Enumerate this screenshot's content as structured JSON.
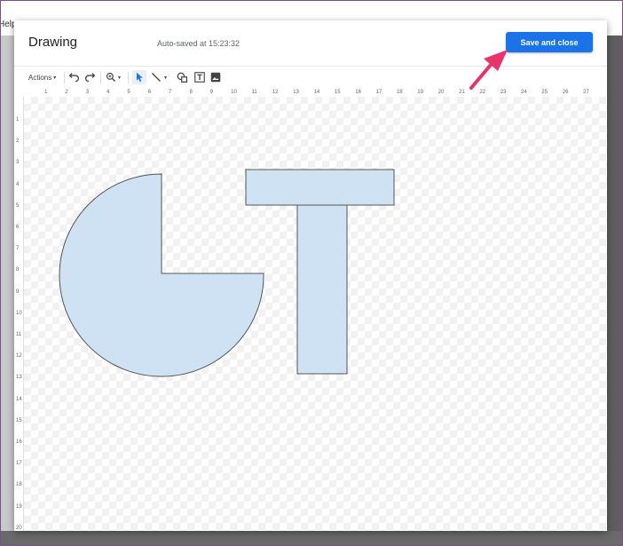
{
  "background": {
    "menu_fragment": "Help"
  },
  "dialog": {
    "title": "Drawing",
    "autosave_text": "Auto-saved at 15:23:32",
    "save_button_label": "Save and close"
  },
  "toolbar": {
    "actions_label": "Actions",
    "tools": [
      "undo-icon",
      "redo-icon",
      "zoom-icon",
      "select-icon",
      "line-icon",
      "shape-icon",
      "text-box-icon",
      "image-icon"
    ]
  },
  "ruler": {
    "horizontal": [
      "1",
      "2",
      "3",
      "4",
      "5",
      "6",
      "7",
      "8",
      "9",
      "10",
      "11",
      "12",
      "13",
      "14",
      "15",
      "16",
      "17",
      "18",
      "19",
      "20",
      "21",
      "22",
      "23",
      "24",
      "25",
      "26",
      "27"
    ],
    "vertical": [
      "1",
      "2",
      "3",
      "4",
      "5",
      "6",
      "7",
      "8",
      "9",
      "10",
      "11",
      "12",
      "13",
      "14",
      "15",
      "16",
      "17",
      "18",
      "19",
      "20"
    ]
  },
  "colors": {
    "accent": "#1a73e8",
    "shape_fill": "#cfe2f3",
    "annotation_arrow": "#e8336d"
  }
}
